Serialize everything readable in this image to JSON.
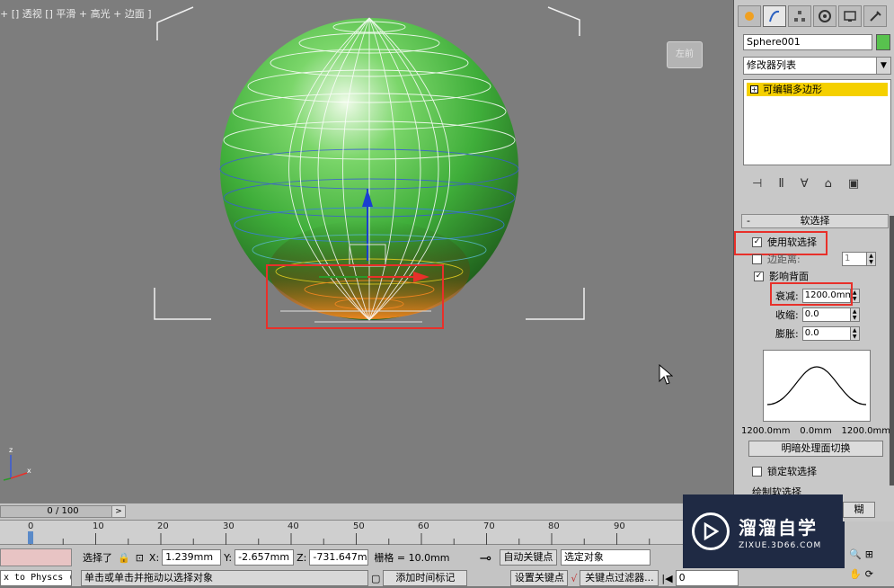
{
  "viewport": {
    "label": "+ [] 透视 [] 平滑 + 高光 + 边面 ]",
    "viewcube_text": "左前",
    "colors": {
      "sphere": "#4caf50",
      "wire": "#ffffff",
      "soft_selection": "#ff7a1a",
      "annotation": "#e8302a"
    }
  },
  "panel": {
    "tabs": [
      "create-icon",
      "modify-icon",
      "hierarchy-icon",
      "motion-icon",
      "display-icon",
      "utilities-icon"
    ],
    "object_name": "Sphere001",
    "object_color": "#58c24e",
    "modifier_list": "修改器列表",
    "modifier_stack": [
      "可编辑多边形"
    ],
    "soft_selection": {
      "title": "软选择",
      "use_soft_selection": "使用软选择",
      "edge_distance": "边距离:",
      "edge_distance_value": "1",
      "affect_backfacing": "影响背面",
      "falloff_label": "衰减:",
      "falloff_value": "1200.0mm",
      "pinch_label": "收缩:",
      "pinch_value": "0.0",
      "bubble_label": "膨胀:",
      "bubble_value": "0.0",
      "curve_left": "1200.0mm",
      "curve_mid": "0.0mm",
      "curve_right": "1200.0mm",
      "shaded_toggle": "明暗处理面切换",
      "lock_soft_selection": "锁定软选择",
      "paint_soft_selection": "绘制软选择",
      "blur": "糊"
    }
  },
  "timeline": {
    "frame_display": "0 / 100",
    "next_button": ">",
    "ticks": [
      "0",
      "10",
      "20",
      "30",
      "40",
      "50",
      "60",
      "70",
      "80",
      "90"
    ]
  },
  "status": {
    "script_listener": "x to Physcs (",
    "selection": "选择了",
    "x_label": "X:",
    "x_value": "1.239mm",
    "y_label": "Y:",
    "y_value": "-2.657mm",
    "z_label": "Z:",
    "z_value": "-731.647m",
    "grid": "栅格 = 10.0mm",
    "auto_key": "自动关键点",
    "selected_object": "选定对象",
    "set_key": "设置关键点",
    "key_filters": "关键点过滤器...",
    "prompt": "单击或单击并拖动以选择对象",
    "add_time_tag": "添加时间标记",
    "frame_value": "0"
  },
  "watermark": {
    "main": "溜溜自学",
    "sub": "ZIXUE.3D66.COM"
  }
}
